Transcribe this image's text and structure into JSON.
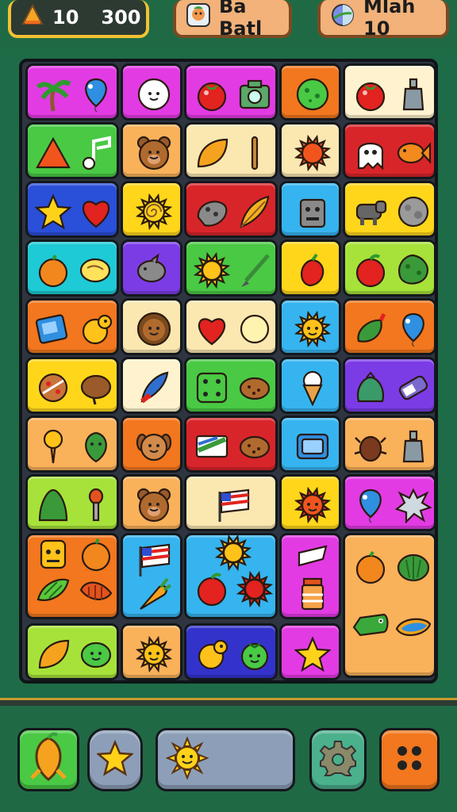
{
  "hud": {
    "left_value_1": "10",
    "left_value_2": "300",
    "middle_label": "Ba Batl",
    "right_label": "Mlah 10"
  },
  "colors": {
    "magenta": "#e23be3",
    "green": "#49c944",
    "blue": "#2a4fd8",
    "cyan": "#1ecad6",
    "orange": "#f2771e",
    "yellow": "#ffd61a",
    "lime": "#a7e23a",
    "cream": "#fbe7b0",
    "light_orange": "#f9b15a",
    "red": "#d8252a",
    "sky": "#36b4ef",
    "purple": "#7b3ce6",
    "navy": "#3333cc",
    "pale": "#fff3cf"
  },
  "tiles": [
    {
      "name": "tile-palm-balloon",
      "color": "magenta",
      "icons": [
        "palm-tree-icon",
        "balloon-icon"
      ]
    },
    {
      "name": "tile-ghost",
      "color": "magenta",
      "icons": [
        "ghost-face-icon"
      ]
    },
    {
      "name": "tile-tomato-camera",
      "color": "magenta",
      "icons": [
        "tomato-icon",
        "camera-icon"
      ]
    },
    {
      "name": "tile-lime-ball",
      "color": "orange",
      "icons": [
        "green-ball-icon"
      ]
    },
    {
      "name": "tile-tomato-bottle",
      "color": "pale",
      "icons": [
        "tomato-icon",
        "bottle-icon"
      ]
    },
    {
      "name": "tile-triangle-note",
      "color": "green",
      "icons": [
        "triangle-icon",
        "music-note-icon"
      ]
    },
    {
      "name": "tile-bear",
      "color": "light_orange",
      "icons": [
        "bear-face-icon"
      ]
    },
    {
      "name": "tile-leaf-stick",
      "color": "cream",
      "icons": [
        "leaf-icon",
        "stick-icon"
      ]
    },
    {
      "name": "tile-crab",
      "color": "cream",
      "icons": [
        "crab-icon"
      ]
    },
    {
      "name": "tile-ghost-fish",
      "color": "red",
      "icons": [
        "ghost-icon",
        "fish-icon"
      ]
    },
    {
      "name": "tile-star-heart",
      "color": "blue",
      "icons": [
        "star-icon",
        "heart-icon"
      ]
    },
    {
      "name": "tile-spiral-sun",
      "color": "yellow",
      "icons": [
        "spiral-sun-icon"
      ]
    },
    {
      "name": "tile-rock-feather",
      "color": "red",
      "icons": [
        "rock-icon",
        "feather-icon"
      ]
    },
    {
      "name": "tile-robot",
      "color": "sky",
      "icons": [
        "robot-icon"
      ]
    },
    {
      "name": "tile-cow-moon",
      "color": "yellow",
      "icons": [
        "cow-icon",
        "moon-icon"
      ]
    },
    {
      "name": "tile-orange-lemon",
      "color": "cyan",
      "icons": [
        "orange-fruit-icon",
        "lemon-icon"
      ]
    },
    {
      "name": "tile-fish-grey",
      "color": "purple",
      "icons": [
        "grey-fish-icon"
      ]
    },
    {
      "name": "tile-sun-brush",
      "color": "green",
      "icons": [
        "sun-icon",
        "brush-icon"
      ]
    },
    {
      "name": "tile-pepper",
      "color": "yellow",
      "icons": [
        "red-pepper-icon"
      ]
    },
    {
      "name": "tile-apple-cactus",
      "color": "lime",
      "icons": [
        "apple-icon",
        "cactus-icon"
      ]
    },
    {
      "name": "tile-block-bird",
      "color": "orange",
      "icons": [
        "blue-block-icon",
        "yellow-bird-icon"
      ]
    },
    {
      "name": "tile-lion",
      "color": "cream",
      "icons": [
        "lion-face-icon"
      ]
    },
    {
      "name": "tile-heart-coin",
      "color": "cream",
      "icons": [
        "heart-icon",
        "coin-icon"
      ]
    },
    {
      "name": "tile-sun-face",
      "color": "sky",
      "icons": [
        "sun-face-icon"
      ]
    },
    {
      "name": "tile-pepper-balloon",
      "color": "orange",
      "icons": [
        "green-pepper-icon",
        "balloon-icon"
      ]
    },
    {
      "name": "tile-pizza-potato",
      "color": "yellow",
      "icons": [
        "pizza-icon",
        "potato-icon"
      ]
    },
    {
      "name": "tile-feather",
      "color": "pale",
      "icons": [
        "blue-feather-icon"
      ]
    },
    {
      "name": "tile-dice-cookie",
      "color": "green",
      "icons": [
        "dice-icon",
        "cookie-icon"
      ]
    },
    {
      "name": "tile-icecream",
      "color": "sky",
      "icons": [
        "ice-cream-icon"
      ]
    },
    {
      "name": "tile-bag-can",
      "color": "purple",
      "icons": [
        "bag-icon",
        "spray-can-icon"
      ]
    },
    {
      "name": "tile-torch-leaf",
      "color": "light_orange",
      "icons": [
        "torch-icon",
        "green-leaf-icon"
      ]
    },
    {
      "name": "tile-dog",
      "color": "orange",
      "icons": [
        "dog-face-icon"
      ]
    },
    {
      "name": "tile-flag-cookie",
      "color": "red",
      "icons": [
        "flag-card-icon",
        "cookie-icon"
      ]
    },
    {
      "name": "tile-radio",
      "color": "sky",
      "icons": [
        "radio-icon"
      ]
    },
    {
      "name": "tile-beetle-bottle",
      "color": "light_orange",
      "icons": [
        "beetle-icon",
        "bottle-icon"
      ]
    },
    {
      "name": "tile-bush-mic",
      "color": "lime",
      "icons": [
        "bush-icon",
        "microphone-icon"
      ]
    },
    {
      "name": "tile-bear2",
      "color": "light_orange",
      "icons": [
        "bear-face-icon"
      ]
    },
    {
      "name": "tile-flag",
      "color": "cream",
      "icons": [
        "flag-icon"
      ]
    },
    {
      "name": "tile-red-sun",
      "color": "yellow",
      "icons": [
        "red-sun-icon"
      ]
    },
    {
      "name": "tile-balloon-splat",
      "color": "magenta",
      "icons": [
        "balloon-icon",
        "splat-icon"
      ]
    },
    {
      "name": "tile-robot-face-fruits",
      "color": "orange",
      "icons": [
        "robot-face-icon",
        "orange-fruit-icon",
        "caterpillar-icon",
        "worm-icon"
      ]
    },
    {
      "name": "tile-flag-carrot",
      "color": "sky",
      "icons": [
        "flag-icon",
        "carrot-icon"
      ]
    },
    {
      "name": "tile-sun-apple-urchin",
      "color": "sky",
      "icons": [
        "sun-icon",
        "apple-icon",
        "urchin-icon"
      ]
    },
    {
      "name": "tile-card-jar",
      "color": "magenta",
      "icons": [
        "card-icon",
        "jar-icon"
      ]
    },
    {
      "name": "tile-orange-melon-lizard-lake",
      "color": "light_orange",
      "icons": [
        "orange-fruit-icon",
        "melon-icon",
        "lizard-icon",
        "lake-icon"
      ]
    },
    {
      "name": "tile-leaf-blob",
      "color": "lime",
      "icons": [
        "leaf-icon",
        "green-blob-icon"
      ]
    },
    {
      "name": "tile-sun-orange",
      "color": "light_orange",
      "icons": [
        "sun-face-icon"
      ]
    },
    {
      "name": "tile-bird-berry",
      "color": "navy",
      "icons": [
        "yellow-bird-icon",
        "green-berry-icon"
      ]
    },
    {
      "name": "tile-star",
      "color": "magenta",
      "icons": [
        "star-icon"
      ]
    }
  ],
  "bottom": {
    "buttons": [
      "fruit-button",
      "star-button",
      "sun-panel",
      "settings-button",
      "menu-button"
    ]
  }
}
